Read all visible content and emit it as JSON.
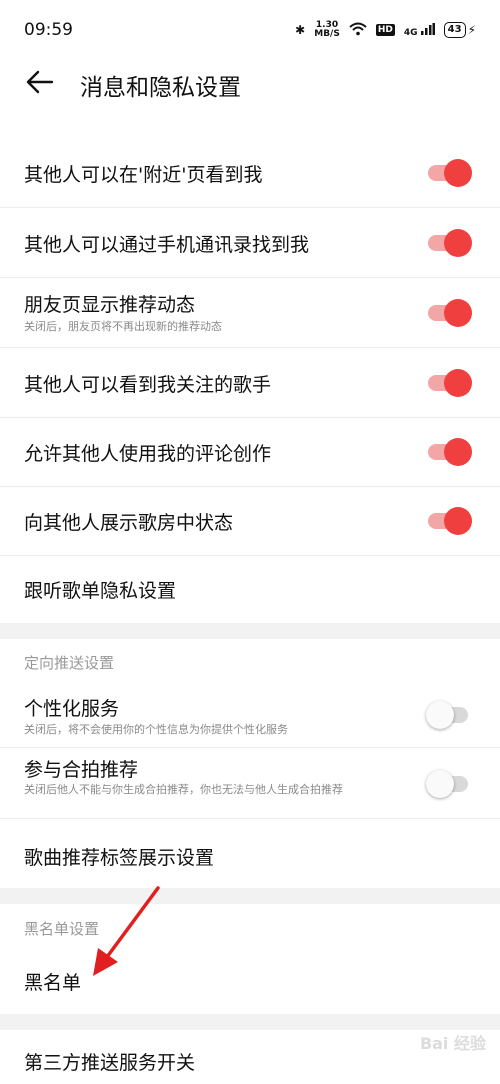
{
  "status_bar": {
    "time": "09:59",
    "speed_value": "1.30",
    "speed_unit": "MB/S",
    "hd": "HD",
    "network": "4G",
    "battery": "43"
  },
  "header": {
    "title": "消息和隐私设置"
  },
  "rows": [
    {
      "label": "其他人可以在'附近'页看到我",
      "toggle": "on"
    },
    {
      "label": "其他人可以通过手机通讯录找到我",
      "toggle": "on"
    },
    {
      "label": "朋友页显示推荐动态",
      "sublabel": "关闭后，朋友页将不再出现新的推荐动态",
      "toggle": "on"
    },
    {
      "label": "其他人可以看到我关注的歌手",
      "toggle": "on"
    },
    {
      "label": "允许其他人使用我的评论创作",
      "toggle": "on"
    },
    {
      "label": "向其他人展示歌房中状态",
      "toggle": "on"
    },
    {
      "label": "跟听歌单隐私设置"
    }
  ],
  "section_push": {
    "header": "定向推送设置",
    "personalized": {
      "label": "个性化服务",
      "sublabel": "关闭后，将不会使用你的个性信息为你提供个性化服务",
      "toggle": "off"
    },
    "duet": {
      "label": "参与合拍推荐",
      "sublabel": "关闭后他人不能与你生成合拍推荐，你也无法与他人生成合拍推荐",
      "toggle": "off"
    },
    "tags": {
      "label": "歌曲推荐标签展示设置"
    }
  },
  "section_blacklist": {
    "header": "黑名单设置",
    "blacklist": {
      "label": "黑名单"
    }
  },
  "third_party": {
    "label": "第三方推送服务开关"
  },
  "watermark": "Bai 经验",
  "colors": {
    "accent": "#f03f3f",
    "accent_track": "#f3a6a6",
    "section_bg": "#f2f2f2"
  }
}
